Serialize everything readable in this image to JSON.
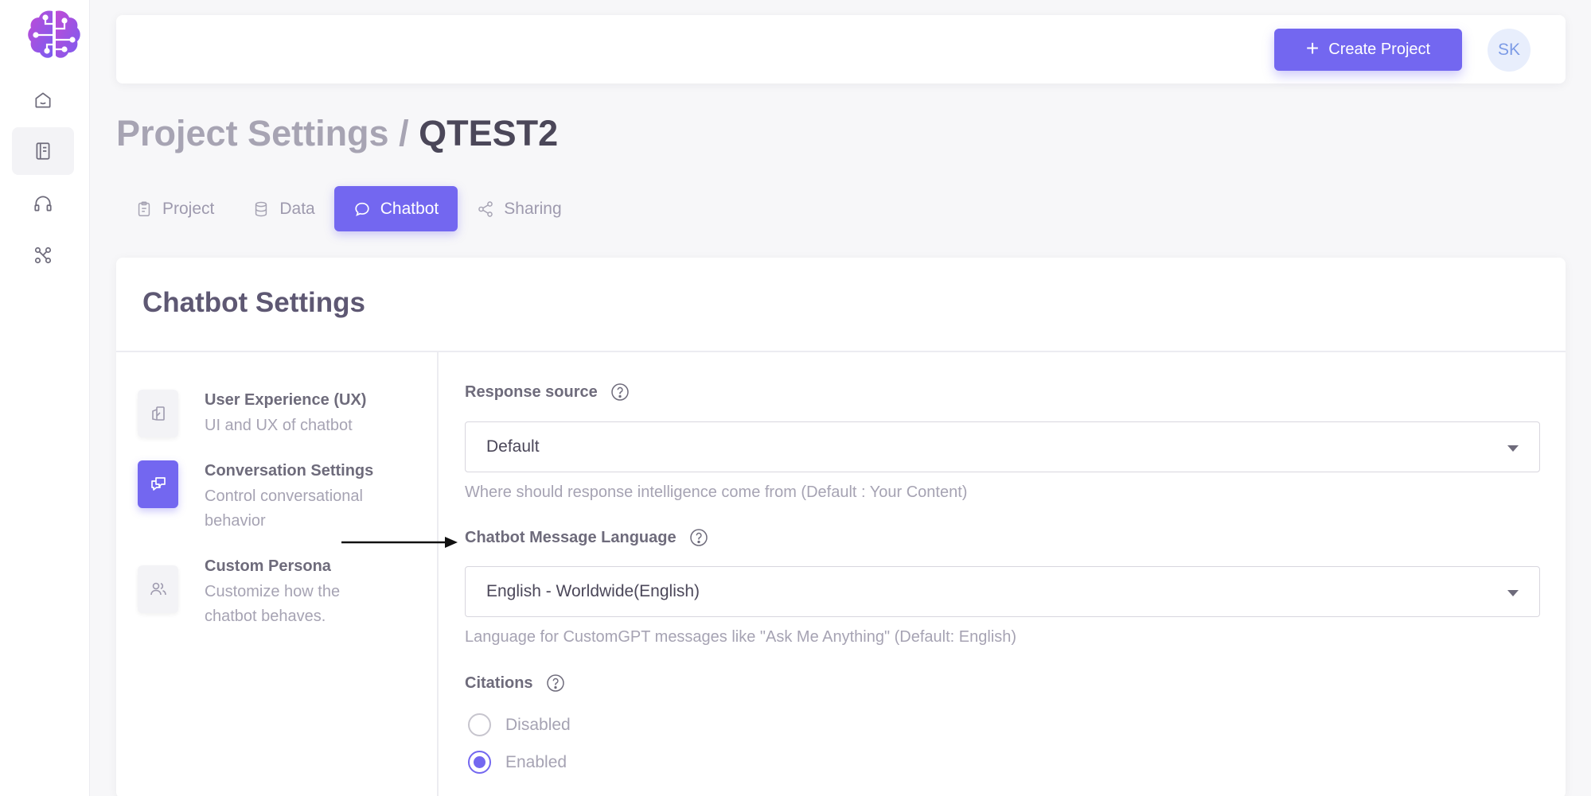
{
  "topbar": {
    "create_label": "Create Project",
    "avatar_initials": "SK"
  },
  "breadcrumb": {
    "section": "Project Settings /",
    "project": "QTEST2"
  },
  "tabs": [
    {
      "label": "Project",
      "icon": "clipboard-icon"
    },
    {
      "label": "Data",
      "icon": "database-icon"
    },
    {
      "label": "Chatbot",
      "icon": "chat-icon",
      "active": true
    },
    {
      "label": "Sharing",
      "icon": "share-icon"
    }
  ],
  "card": {
    "title": "Chatbot Settings"
  },
  "menu": [
    {
      "title": "User Experience (UX)",
      "subtitle": "UI and UX of chatbot",
      "icon": "layout-icon"
    },
    {
      "title": "Conversation Settings",
      "subtitle": "Control conversational behavior",
      "icon": "conversation-icon",
      "active": true
    },
    {
      "title": "Custom Persona",
      "subtitle": "Customize how the chatbot behaves.",
      "icon": "users-icon"
    }
  ],
  "form": {
    "response_source": {
      "label": "Response source",
      "value": "Default",
      "hint": "Where should response intelligence come from (Default : Your Content)"
    },
    "message_language": {
      "label": "Chatbot Message Language",
      "value": "English - Worldwide(English)",
      "hint": "Language for CustomGPT messages like \"Ask Me Anything\" (Default: English)"
    },
    "citations": {
      "label": "Citations",
      "options": [
        "Disabled",
        "Enabled"
      ],
      "selected": "Enabled"
    }
  },
  "colors": {
    "accent": "#7367f0",
    "text": "#5e5873",
    "muted": "#a6a3b3"
  }
}
